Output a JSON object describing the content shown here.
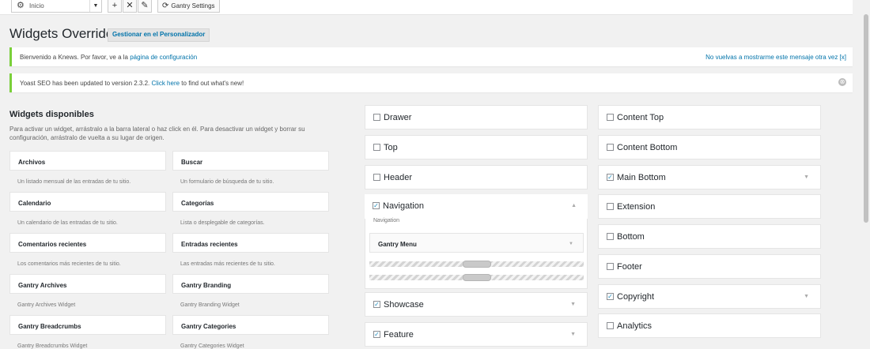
{
  "toolbar": {
    "select_value": "Inicio",
    "add_label": "+",
    "delete_label": "✕",
    "edit_label": "✎",
    "settings_label": "Gantry Settings"
  },
  "page": {
    "title": "Widgets Override",
    "customizer_button": "Gestionar en el Personalizador"
  },
  "notices": {
    "knews_text": "Bienvenido a Knews. Por favor, ve a la ",
    "knews_link": "página de configuración",
    "knews_dismiss": "No vuelvas a mostrarme este mensaje otra vez [x]",
    "yoast_text": "Yoast SEO has been updated to version 2.3.2. ",
    "yoast_link": "Click here",
    "yoast_tail": " to find out what's new!"
  },
  "available": {
    "heading": "Widgets disponibles",
    "description": "Para activar un widget, arrástralo a la barra lateral o haz click en él. Para desactivar un widget y borrar su configuración, arrástralo de vuelta a su lugar de origen.",
    "widgets": [
      {
        "name": "Archivos",
        "desc": "Un listado mensual de las entradas de tu sitio."
      },
      {
        "name": "Buscar",
        "desc": "Un formulario de búsqueda de tu sitio."
      },
      {
        "name": "Calendario",
        "desc": "Un calendario de las entradas de tu sitio."
      },
      {
        "name": "Categorías",
        "desc": "Lista o desplegable de categorías."
      },
      {
        "name": "Comentarios recientes",
        "desc": "Los comentarios más recientes de tu sitio."
      },
      {
        "name": "Entradas recientes",
        "desc": "Las entradas más recientes de tu sitio."
      },
      {
        "name": "Gantry Archives",
        "desc": "Gantry Archives Widget"
      },
      {
        "name": "Gantry Branding",
        "desc": "Gantry Branding Widget"
      },
      {
        "name": "Gantry Breadcrumbs",
        "desc": "Gantry Breadcrumbs Widget"
      },
      {
        "name": "Gantry Categories",
        "desc": "Gantry Categories Widget"
      }
    ]
  },
  "sidebars_left": [
    {
      "label": "Drawer",
      "checked": false
    },
    {
      "label": "Top",
      "checked": false
    },
    {
      "label": "Header",
      "checked": false
    },
    {
      "label": "Navigation",
      "checked": true,
      "subtitle": "Navigation",
      "widget": "Gantry Menu"
    },
    {
      "label": "Showcase",
      "checked": true
    },
    {
      "label": "Feature",
      "checked": true
    }
  ],
  "sidebars_right": [
    {
      "label": "Content Top",
      "checked": false
    },
    {
      "label": "Content Bottom",
      "checked": false
    },
    {
      "label": "Main Bottom",
      "checked": true
    },
    {
      "label": "Extension",
      "checked": false
    },
    {
      "label": "Bottom",
      "checked": false
    },
    {
      "label": "Footer",
      "checked": false
    },
    {
      "label": "Copyright",
      "checked": true
    },
    {
      "label": "Analytics",
      "checked": false
    }
  ],
  "icons": {
    "check": "✓",
    "chevron_down": "▼",
    "chevron_up": "▲",
    "gear": "⚙",
    "settings": "⟳",
    "dismiss": "⊗"
  }
}
